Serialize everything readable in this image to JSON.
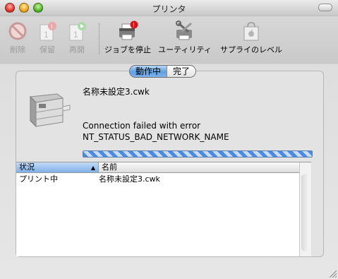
{
  "window": {
    "title": "プリンタ"
  },
  "toolbar": {
    "delete_label": "削除",
    "hold_label": "保留",
    "resume_label": "再開",
    "stop_jobs_label": "ジョブを停止",
    "utility_label": "ユーティリティ",
    "supply_label": "サプライのレベル"
  },
  "tabs": {
    "active": "動作中",
    "completed": "完了"
  },
  "job": {
    "name": "名称未設定3.cwk",
    "message_line1": "Connection failed with error",
    "message_line2": "NT_STATUS_BAD_NETWORK_NAME"
  },
  "table": {
    "headers": {
      "status": "状況",
      "name": "名前"
    },
    "rows": [
      {
        "status": "プリント中",
        "name": "名称未設定3.cwk"
      }
    ]
  },
  "colors": {
    "accent": "#5f9fe2",
    "progress": "#4a8ae0"
  }
}
